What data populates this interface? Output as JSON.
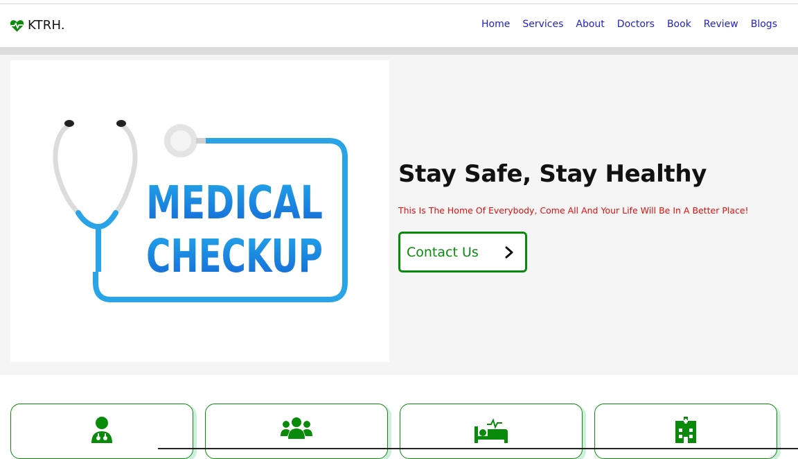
{
  "header": {
    "brand": "KTRH.",
    "brand_icon": "heartbeat-icon",
    "nav": [
      "Home",
      "Services",
      "About",
      "Doctors",
      "Book",
      "Review",
      "Blogs"
    ]
  },
  "hero": {
    "image_text": [
      "MEDICAL",
      "CHECKUP"
    ],
    "title": "Stay Safe, Stay Healthy",
    "subtitle": "This Is The Home Of Everybody, Come All And Your Life Will Be In A Better Place!",
    "button_label": "Contact Us",
    "button_icon": "chevron-right-icon"
  },
  "cards": [
    {
      "icon": "user-doctor-icon"
    },
    {
      "icon": "users-icon"
    },
    {
      "icon": "hospital-bed-icon"
    },
    {
      "icon": "hospital-building-icon"
    }
  ],
  "colors": {
    "nav_link": "#1d1fd4",
    "accent_green": "#0a8a0a",
    "subtitle_red": "#e01010",
    "hero_bg": "#f5f5f5"
  }
}
